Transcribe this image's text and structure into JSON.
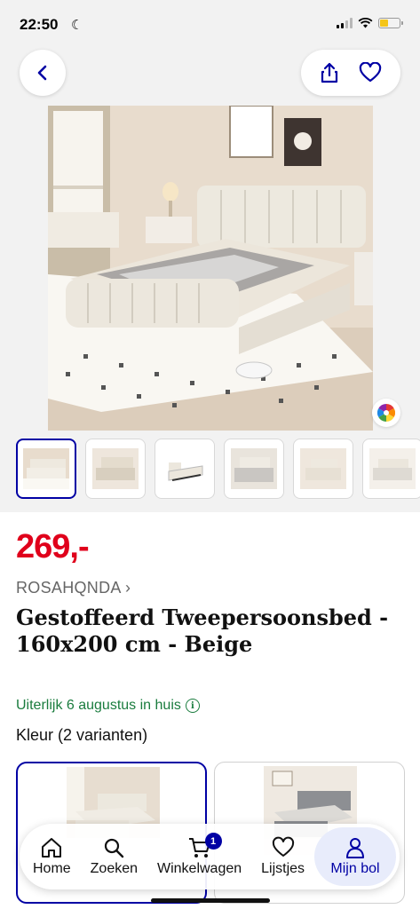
{
  "status_bar": {
    "time": "22:50"
  },
  "product": {
    "price": "269,-",
    "brand": "ROSAHQNDA ›",
    "title": "Gestoffeerd Tweepersoonsbed - 160x200 cm - Beige",
    "delivery": "Uiterlijk 6 augustus in huis",
    "variants_label": "Kleur (2 varianten)"
  },
  "thumbnails_count": 6,
  "colors": {
    "price_red": "#e0001b",
    "brand_blue": "#0000a4",
    "delivery_green": "#1a7c3e"
  },
  "bottom_nav": {
    "items": [
      {
        "label": "Home",
        "icon": "home-icon"
      },
      {
        "label": "Zoeken",
        "icon": "search-icon"
      },
      {
        "label": "Winkelwagen",
        "icon": "cart-icon",
        "badge": "1"
      },
      {
        "label": "Lijstjes",
        "icon": "heart-icon"
      },
      {
        "label": "Mijn bol",
        "icon": "user-icon",
        "active": true
      }
    ]
  }
}
